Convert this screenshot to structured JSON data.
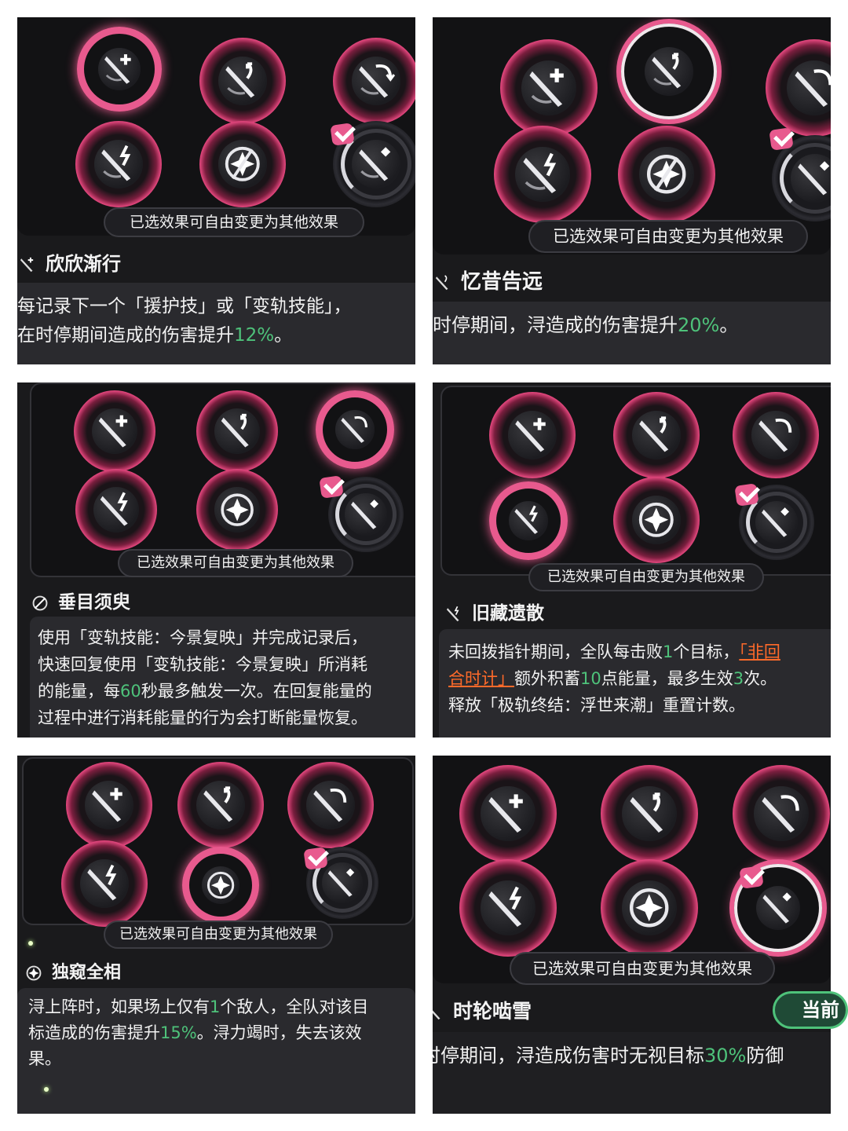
{
  "colors": {
    "accent": "#e85a8e",
    "highlight_green": "#4ec27a",
    "highlight_orange": "#ff6a2a",
    "panel_bg": "#1a1a1c"
  },
  "icons": [
    "dagger-plus-icon",
    "dagger-arrow-icon",
    "dagger-rotate-icon",
    "dagger-lightning-icon",
    "shield-star-icon",
    "dagger-diamond-icon"
  ],
  "hint": "已选效果可自由变更为其他效果",
  "panels": [
    {
      "title": "欣欣渐行",
      "desc_lines": [
        [
          "每记录下一个「援护技」或「变轨技能」，"
        ],
        [
          "在时停期间造成的伤害提升",
          "12%",
          "。"
        ]
      ]
    },
    {
      "title": "忆昔告远",
      "desc_lines": [
        [
          "时停期间，浔造成的伤害提升",
          "20%",
          "。"
        ]
      ]
    },
    {
      "title": "垂目须臾",
      "desc_lines": [
        [
          "使用「变轨技能：今景复映」并完成记录后，"
        ],
        [
          "快速回复使用「变轨技能：今景复映」所消耗"
        ],
        [
          "的能量，每",
          "60",
          "秒最多触发一次。在回复能量的"
        ],
        [
          "过程中进行消耗能量的行为会打断能量恢复。"
        ]
      ]
    },
    {
      "title": "旧藏遗散",
      "desc_lines": [
        [
          "未回拨指针期间，全队每击败",
          "1",
          "个目标，",
          "「非回"
        ],
        [
          "合时计」",
          "额外积蓄",
          "10",
          "点能量，最多生效",
          "3",
          "次。"
        ],
        [
          "释放「极轨终结：浮世来潮」重置计数。"
        ]
      ]
    },
    {
      "title": "独窥全相",
      "desc_lines": [
        [
          "浔上阵时，如果场上仅有",
          "1",
          "个敌人，全队对该目"
        ],
        [
          "标造成的伤害提升",
          "15%",
          "。浔力竭时，失去该效"
        ],
        [
          "果。"
        ]
      ]
    },
    {
      "title": "时轮啮雪",
      "desc_lines": [
        [
          "时停期间，浔造成伤害时无视目标",
          "30%",
          "防御"
        ]
      ],
      "button": "当前"
    }
  ]
}
